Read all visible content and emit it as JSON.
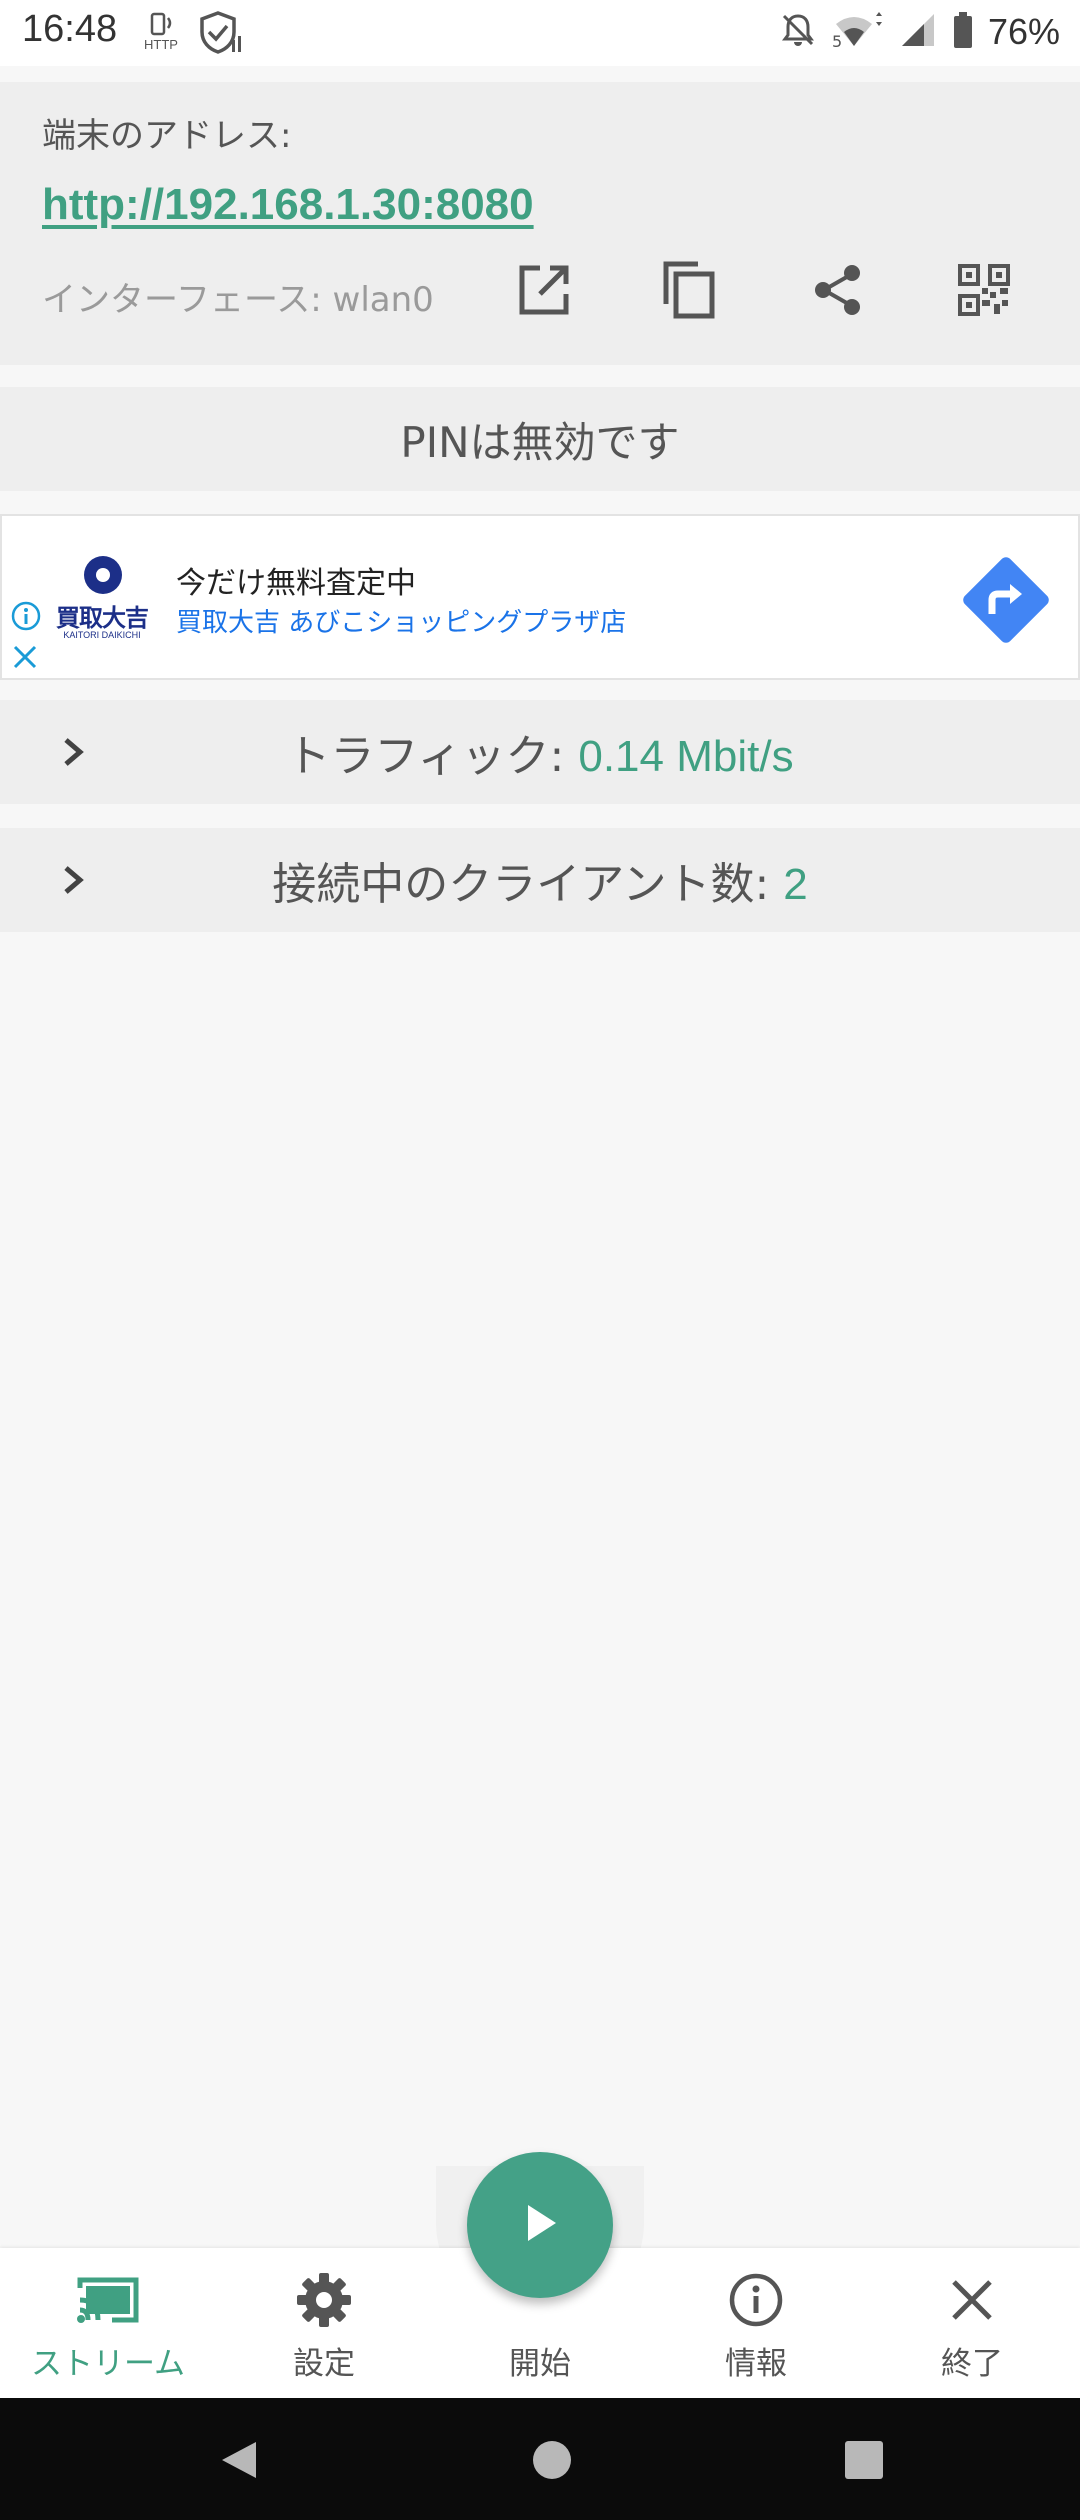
{
  "status_bar": {
    "time": "16:48",
    "http_label": "HTTP",
    "network_label": "5",
    "battery_percent": "76%"
  },
  "address_card": {
    "label": "端末のアドレス:",
    "url": "http://192.168.1.30:8080",
    "interface_label": "インターフェース: wlan0",
    "actions": [
      "open-in-browser-icon",
      "copy-icon",
      "share-icon",
      "qr-code-icon"
    ]
  },
  "pin_card": {
    "text": "PINは無効です"
  },
  "ad": {
    "logo_text": "買取大吉",
    "logo_subtext": "KAITORI DAIKICHI",
    "title": "今だけ無料査定中",
    "subtitle": "買取大吉 あびこショッピングプラザ店",
    "colors": {
      "brand": "#1c2f88",
      "link": "#1a73e8",
      "direction": "#4285f4"
    }
  },
  "traffic": {
    "label": "トラフィック: ",
    "value": "0.14 Mbit/s"
  },
  "clients": {
    "label": "接続中のクライアント数: ",
    "value": "2"
  },
  "bottom_nav": {
    "items": [
      {
        "label": "ストリーム",
        "icon": "cast-icon",
        "active": true
      },
      {
        "label": "設定",
        "icon": "gear-icon",
        "active": false
      },
      {
        "label": "開始",
        "icon": "play-icon",
        "active": false
      },
      {
        "label": "情報",
        "icon": "info-icon",
        "active": false
      },
      {
        "label": "終了",
        "icon": "close-icon",
        "active": false
      }
    ]
  },
  "colors": {
    "accent": "#40a082",
    "fab": "#44a187",
    "card_bg": "#eeeeee",
    "page_bg": "#f7f7f7"
  }
}
